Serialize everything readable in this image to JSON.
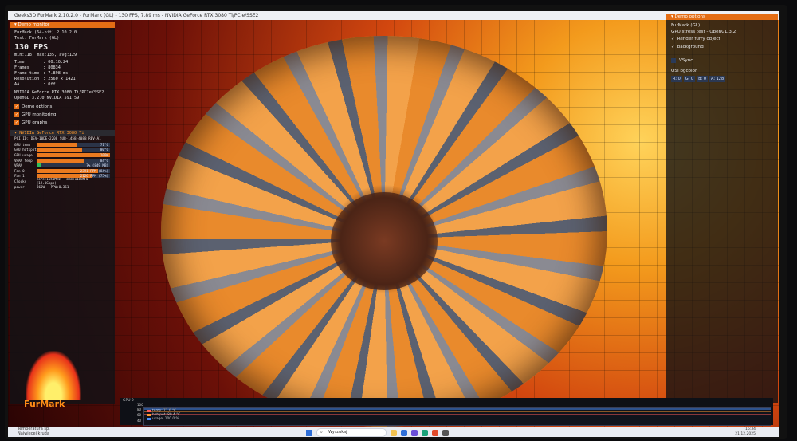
{
  "window": {
    "title": "Geeks3D FurMark 2.10.2.0 - FurMark (GL) - 130 FPS, 7.89 ms - NVIDIA GeForce RTX 3080 Ti/PCIe/SSE2"
  },
  "left_panel": {
    "header": "Demo monitor",
    "app_line": "FurMark (64-bit) 2.10.2.0",
    "test_line": "Test: FurMark (GL)",
    "fps": "130 FPS",
    "fps_range": "min:118, max:135, avg:129",
    "stats": [
      {
        "k": "Time",
        "v": ": 00:10:24"
      },
      {
        "k": "Frames",
        "v": ": 80834"
      },
      {
        "k": "Frame time",
        "v": ": 7.898 ms"
      },
      {
        "k": "Resolution",
        "v": ": 2560 x 1421"
      },
      {
        "k": "AA",
        "v": ": Off"
      }
    ],
    "renderer": "NVIDIA GeForce RTX 3080 Ti/PCIe/SSE2",
    "gl_version": "OpenGL 3.2.0 NVIDIA 591.59",
    "checkboxes": [
      "Demo options",
      "GPU monitoring",
      "GPU graphs"
    ]
  },
  "gpu_monitor": {
    "header": "NVIDIA GeForce RTX 3080 Ti",
    "pci": "PCI ID: DEV-10DE-2208 SUB-1458-4088 REV-A1",
    "rows": [
      {
        "k": "GPU temp",
        "v": "71°C",
        "pct": 0.55
      },
      {
        "k": "GPU hotspot",
        "v": "80°C",
        "pct": 0.62
      },
      {
        "k": "GPU usage",
        "v": "100%",
        "pct": 1.0
      },
      {
        "k": "VRAM temp",
        "v": "84°C",
        "pct": 0.65
      },
      {
        "k": "VRAM",
        "v": "7% (849 MB)",
        "pct": 0.07
      },
      {
        "k": "Fan 0",
        "v": "2391 RPM (84%)",
        "pct": 0.84
      },
      {
        "k": "Fan 1",
        "v": "2126 RPM (75%)",
        "pct": 0.75
      }
    ],
    "clocks": "core:1650MHz - mem:1188MHz (19.0Gbps)",
    "power": "360W - PPW:0.361"
  },
  "logo_text": "FurMark",
  "right_panel": {
    "header": "Demo options",
    "demo_name": "FurMark (GL)",
    "demo_desc": "GPU stress test - OpenGL 3.2",
    "checkboxes": [
      "Render furry object",
      "background"
    ],
    "vsync": "VSync",
    "osi_label": "OSI bgcolor",
    "color_fields": [
      "R: 0",
      "G: 0",
      "B: 0",
      "A: 128"
    ]
  },
  "graph": {
    "title": "GPU 0",
    "axis": [
      "100",
      "80",
      "60",
      "40"
    ],
    "legend": [
      {
        "label": "temp: 71.0 °C",
        "color": "#ff5a5a"
      },
      {
        "label": "hotspot: 80.4 °C",
        "color": "#ff9a2e"
      },
      {
        "label": "usage: 100.0 %",
        "color": "#4a90ff"
      }
    ]
  },
  "taskbar": {
    "weather_line1": "Temperatura sp.",
    "weather_line2": "Najwięcej kruda",
    "search_placeholder": "Wyszukaj",
    "time": "16:34",
    "date": "21.12.2025"
  }
}
